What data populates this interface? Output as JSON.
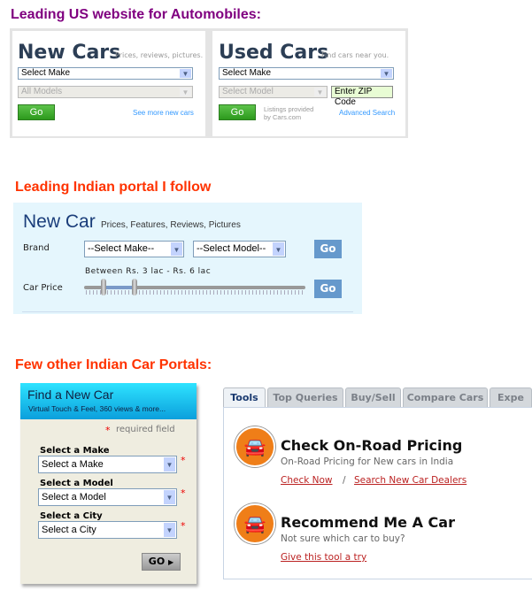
{
  "sections": {
    "us": {
      "heading": "Leading US website for Automobiles:",
      "heading_color": "#800080",
      "new": {
        "title": "New Cars",
        "subtitle": "Prices, reviews, pictures.",
        "make": "Select Make",
        "model": "All Models",
        "go": "Go",
        "link": "See more new cars"
      },
      "used": {
        "title": "Used Cars",
        "subtitle": "Find cars near you.",
        "make": "Select Make",
        "model": "Select Model",
        "zip": "Enter ZIP Code",
        "go": "Go",
        "listings": "Listings provided by Cars.com",
        "link": "Advanced Search"
      }
    },
    "indian": {
      "heading": "Leading Indian portal I follow",
      "heading_color": "#ff3300",
      "title": "New Car",
      "subtitle": "Prices, Features, Reviews, Pictures",
      "brand_label": "Brand",
      "make": "--Select Make--",
      "model": "--Select Model--",
      "go": "Go",
      "price_label": "Car Price",
      "range_text": "Between Rs. 3 lac - Rs. 6 lac",
      "range_min_lac": 3,
      "range_max_lac": 6,
      "go2": "Go"
    },
    "others": {
      "heading": "Few other Indian Car Portals:",
      "finder": {
        "title": "Find a New Car",
        "subtitle": "Virtual Touch & Feel, 360 views & more...",
        "required": "required field",
        "asterisk": "*",
        "make_label": "Select a Make",
        "make": "Select a Make",
        "model_label": "Select a Model",
        "model": "Select a Model",
        "city_label": "Select a City",
        "city": "Select a City",
        "go": "GO"
      },
      "tools": {
        "tabs": [
          "Tools",
          "Top Queries",
          "Buy/Sell",
          "Compare Cars",
          "Expe"
        ],
        "active_tab": "Tools",
        "items": [
          {
            "title": "Check On-Road Pricing",
            "desc": "On-Road Pricing for New cars in India",
            "link1": "Check Now",
            "sep": "/",
            "link2": "Search New Car Dealers"
          },
          {
            "title": "Recommend Me A Car",
            "desc": "Not sure which car to buy?",
            "link1": "Give this tool a try"
          }
        ]
      }
    }
  }
}
